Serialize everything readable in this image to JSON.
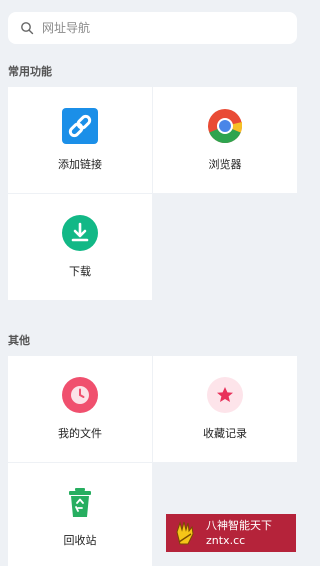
{
  "search": {
    "placeholder": "网址导航"
  },
  "sections": {
    "common": {
      "title": "常用功能",
      "items": [
        {
          "label": "添加链接",
          "icon": "link-icon"
        },
        {
          "label": "浏览器",
          "icon": "chrome-icon"
        },
        {
          "label": "下载",
          "icon": "download-icon"
        }
      ]
    },
    "other": {
      "title": "其他",
      "items": [
        {
          "label": "我的文件",
          "icon": "clock-icon"
        },
        {
          "label": "收藏记录",
          "icon": "star-icon"
        },
        {
          "label": "回收站",
          "icon": "recycle-bin-icon"
        }
      ]
    }
  },
  "watermark": {
    "line1": "八神智能天下",
    "line2": "zntx.cc"
  },
  "colors": {
    "background": "#eef1f5",
    "link_blue": "#1b8fe8",
    "download_green": "#12b886",
    "clock_red": "#f0506e",
    "star_red": "#e8315a",
    "recycle_green": "#27ae60",
    "watermark_red": "#b5233a"
  }
}
